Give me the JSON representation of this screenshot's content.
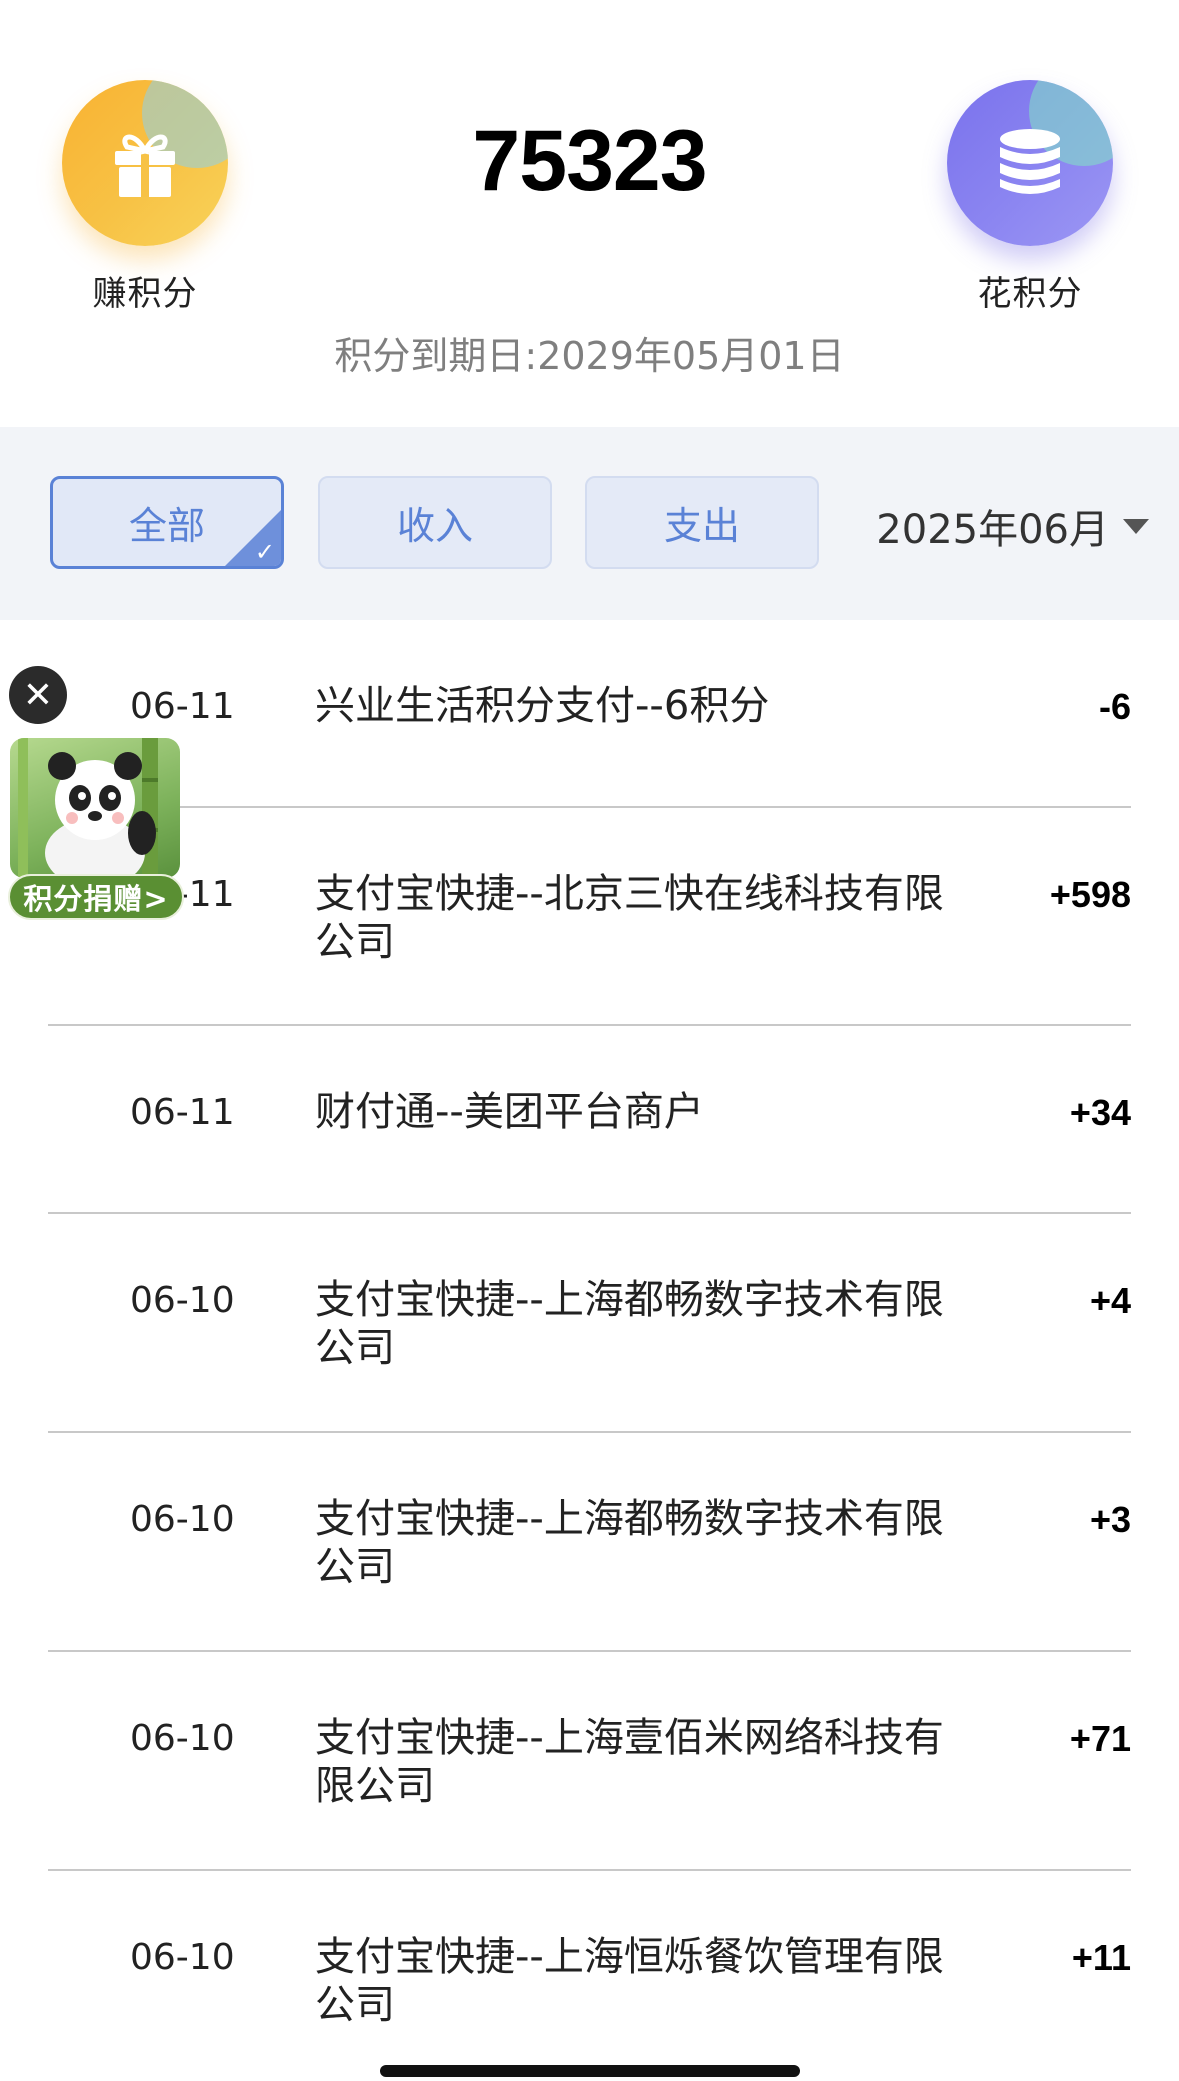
{
  "header": {
    "balance": "75323",
    "expiry": "积分到期日:2029年05月01日",
    "earn_label": "赚积分",
    "spend_label": "花积分",
    "earn_icon": "gift-icon",
    "spend_icon": "coins-icon",
    "colors": {
      "earn": "#f7c245",
      "spend": "#8b85f1"
    }
  },
  "filters": {
    "tabs": [
      {
        "label": "全部",
        "active": true
      },
      {
        "label": "收入",
        "active": false
      },
      {
        "label": "支出",
        "active": false
      }
    ],
    "month": "2025年06月"
  },
  "transactions": [
    {
      "date": "06-11",
      "desc": "兴业生活积分支付--6积分",
      "amount": "-6"
    },
    {
      "date": "06-11",
      "desc": "支付宝快捷--北京三快在线科技有限公司",
      "amount": "+598"
    },
    {
      "date": "06-11",
      "desc": "财付通--美团平台商户",
      "amount": "+34"
    },
    {
      "date": "06-10",
      "desc": "支付宝快捷--上海都畅数字技术有限公司",
      "amount": "+4"
    },
    {
      "date": "06-10",
      "desc": "支付宝快捷--上海都畅数字技术有限公司",
      "amount": "+3"
    },
    {
      "date": "06-10",
      "desc": "支付宝快捷--上海壹佰米网络科技有限公司",
      "amount": "+71"
    },
    {
      "date": "06-10",
      "desc": "支付宝快捷--上海恒烁餐饮管理有限公司",
      "amount": "+11"
    }
  ],
  "floating": {
    "donate_label": "积分捐赠>",
    "close_icon": "close-icon"
  }
}
